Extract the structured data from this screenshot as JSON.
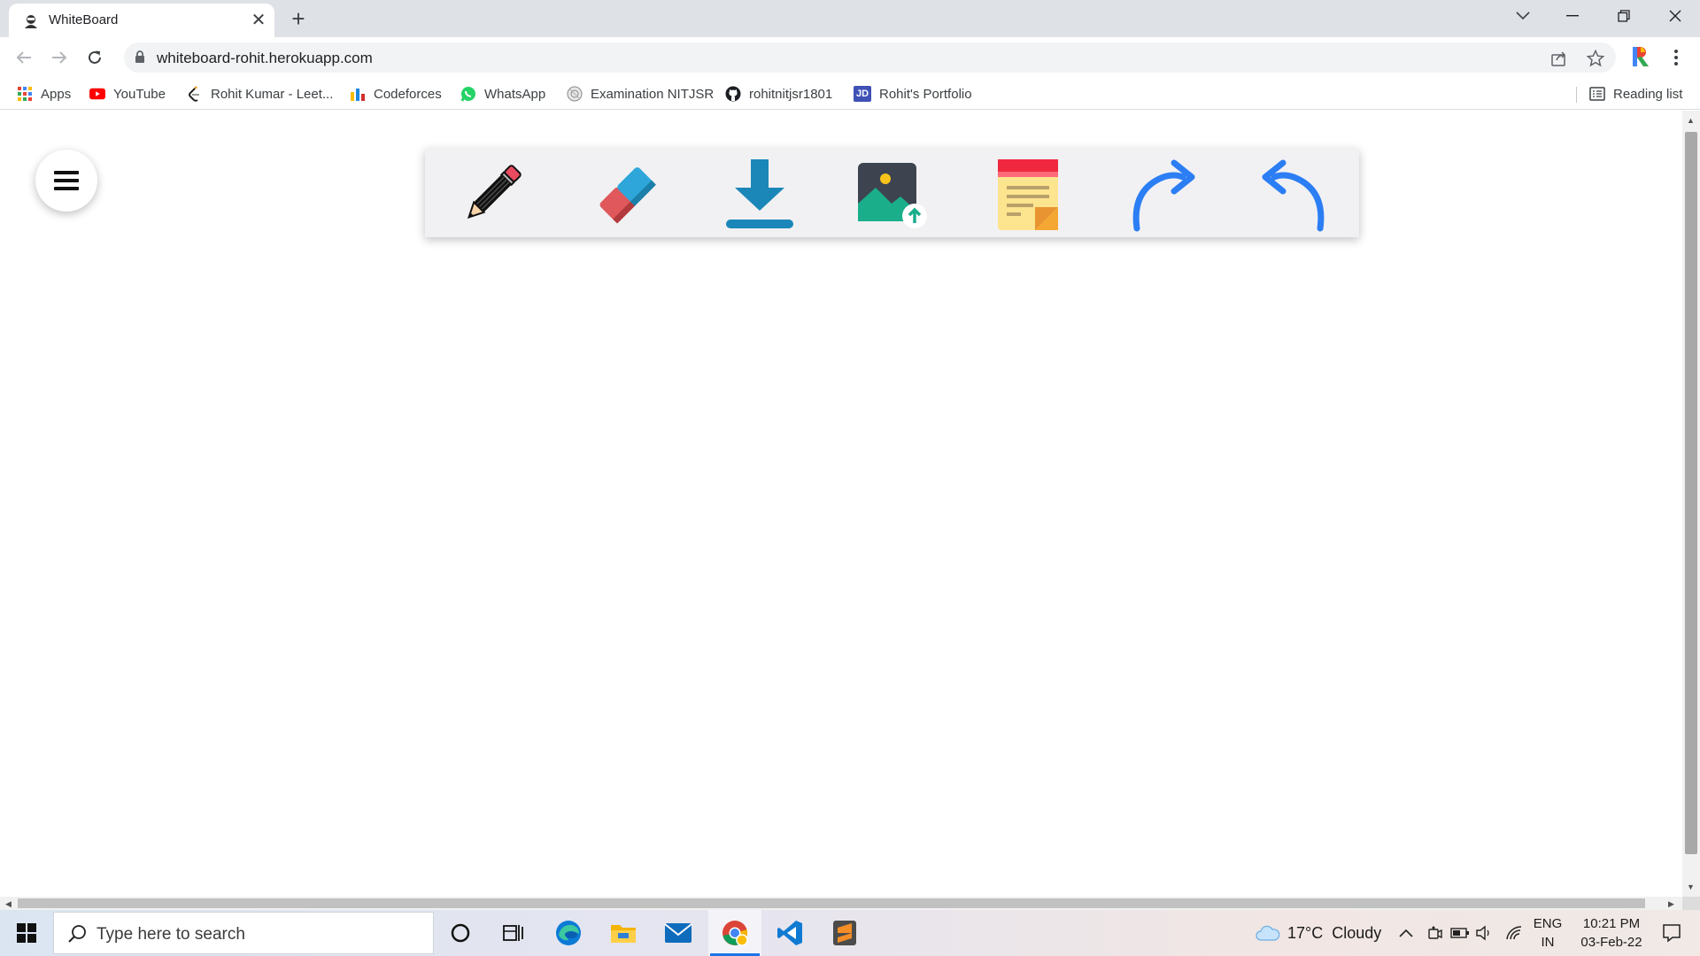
{
  "browser": {
    "tab": {
      "title": "WhiteBoard",
      "close_glyph": "✕"
    },
    "new_tab_glyph": "+",
    "url": "whiteboard-rohit.herokuapp.com",
    "profile_letter": "R",
    "bookmarks": [
      {
        "label": "Apps",
        "icon": "apps-grid-icon"
      },
      {
        "label": "YouTube",
        "icon": "youtube-icon"
      },
      {
        "label": "Rohit Kumar - Leet...",
        "icon": "leetcode-icon"
      },
      {
        "label": "Codeforces",
        "icon": "codeforces-icon"
      },
      {
        "label": "WhatsApp",
        "icon": "whatsapp-icon"
      },
      {
        "label": "Examination NITJSR",
        "icon": "nitjsr-icon"
      },
      {
        "label": "rohitnitjsr1801",
        "icon": "github-icon"
      },
      {
        "label": "Rohit's Portfolio",
        "icon": "portfolio-jd-icon",
        "badge": "JD"
      }
    ],
    "reading_list": "Reading list"
  },
  "app": {
    "tools": [
      "pencil",
      "eraser",
      "download",
      "upload-image",
      "sticky-note",
      "redo",
      "undo"
    ],
    "colors": {
      "toolbar_bg": "#f1f1f3",
      "pencil_red": "#e84a5f",
      "eraser_blue": "#2ea6d9",
      "eraser_red": "#e0585b",
      "download": "#1b87b9",
      "arrows": "#2c7ef4",
      "note_yellow": "#fde48f",
      "note_top": "#f0283f"
    }
  },
  "taskbar": {
    "search_placeholder": "Type here to search",
    "apps": [
      "cortana-icon",
      "task-view-icon",
      "edge-icon",
      "file-explorer-icon",
      "mail-icon",
      "chrome-icon",
      "vscode-icon",
      "sublime-icon"
    ],
    "weather": "17°C  Cloudy",
    "lang_top": "ENG",
    "lang_bottom": "IN",
    "time": "10:21 PM",
    "date": "03-Feb-22"
  }
}
